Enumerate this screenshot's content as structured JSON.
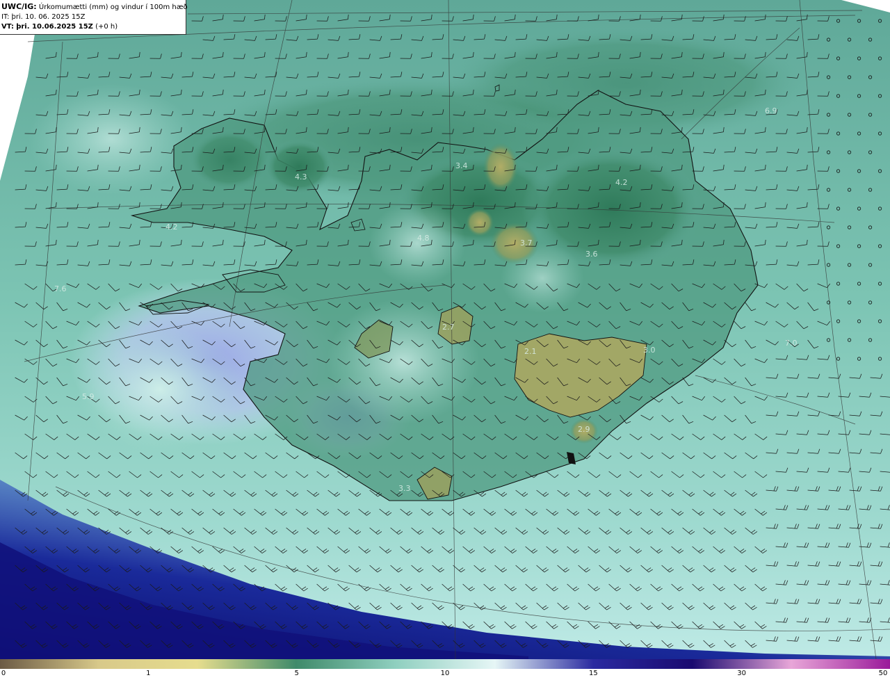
{
  "header": {
    "model": "UWC/IG:",
    "title": "Úrkomumætti (mm) og vindur í 100m hæð",
    "it_label": "IT:",
    "it_value": "þri. 10. 06. 2025 15Z",
    "vt_label": "VT:",
    "vt_value": "þri. 10.06.2025 15Z",
    "vt_offset": "(+0 h)"
  },
  "map_values": [
    {
      "text": "6.9"
    },
    {
      "text": "4.3"
    },
    {
      "text": "3.4"
    },
    {
      "text": "4.2"
    },
    {
      "text": "4.2"
    },
    {
      "text": "3.7"
    },
    {
      "text": "3.6"
    },
    {
      "text": "7.6"
    },
    {
      "text": "2.7"
    },
    {
      "text": "2.1"
    },
    {
      "text": "3.0"
    },
    {
      "text": "7.0"
    },
    {
      "text": "2.9"
    },
    {
      "text": "3.3"
    },
    {
      "text": "4.8"
    },
    {
      "text": "5.9"
    }
  ],
  "colorbar": {
    "ticks": [
      {
        "label": "0",
        "value": 0
      },
      {
        "label": "1",
        "value": 1
      },
      {
        "label": "5",
        "value": 5
      },
      {
        "label": "10",
        "value": 10
      },
      {
        "label": "15",
        "value": 15
      },
      {
        "label": "30",
        "value": 30
      },
      {
        "label": "50",
        "value": 50
      }
    ],
    "colors": [
      "#6b5a45",
      "#d8c98a",
      "#e6dd8e",
      "#3f8a6a",
      "#8fcfbf",
      "#e6f6f6",
      "#2a2aa0",
      "#1a0a70",
      "#e8a6d8",
      "#9a1a9a"
    ]
  },
  "colors": {
    "ocean_base": "#72b9a9",
    "land_low": "#3f8a6a",
    "land_dry": "#a9a860",
    "wet_blue": "#a6b8e6",
    "deep_blue": "#141887",
    "coast": "#111111"
  }
}
